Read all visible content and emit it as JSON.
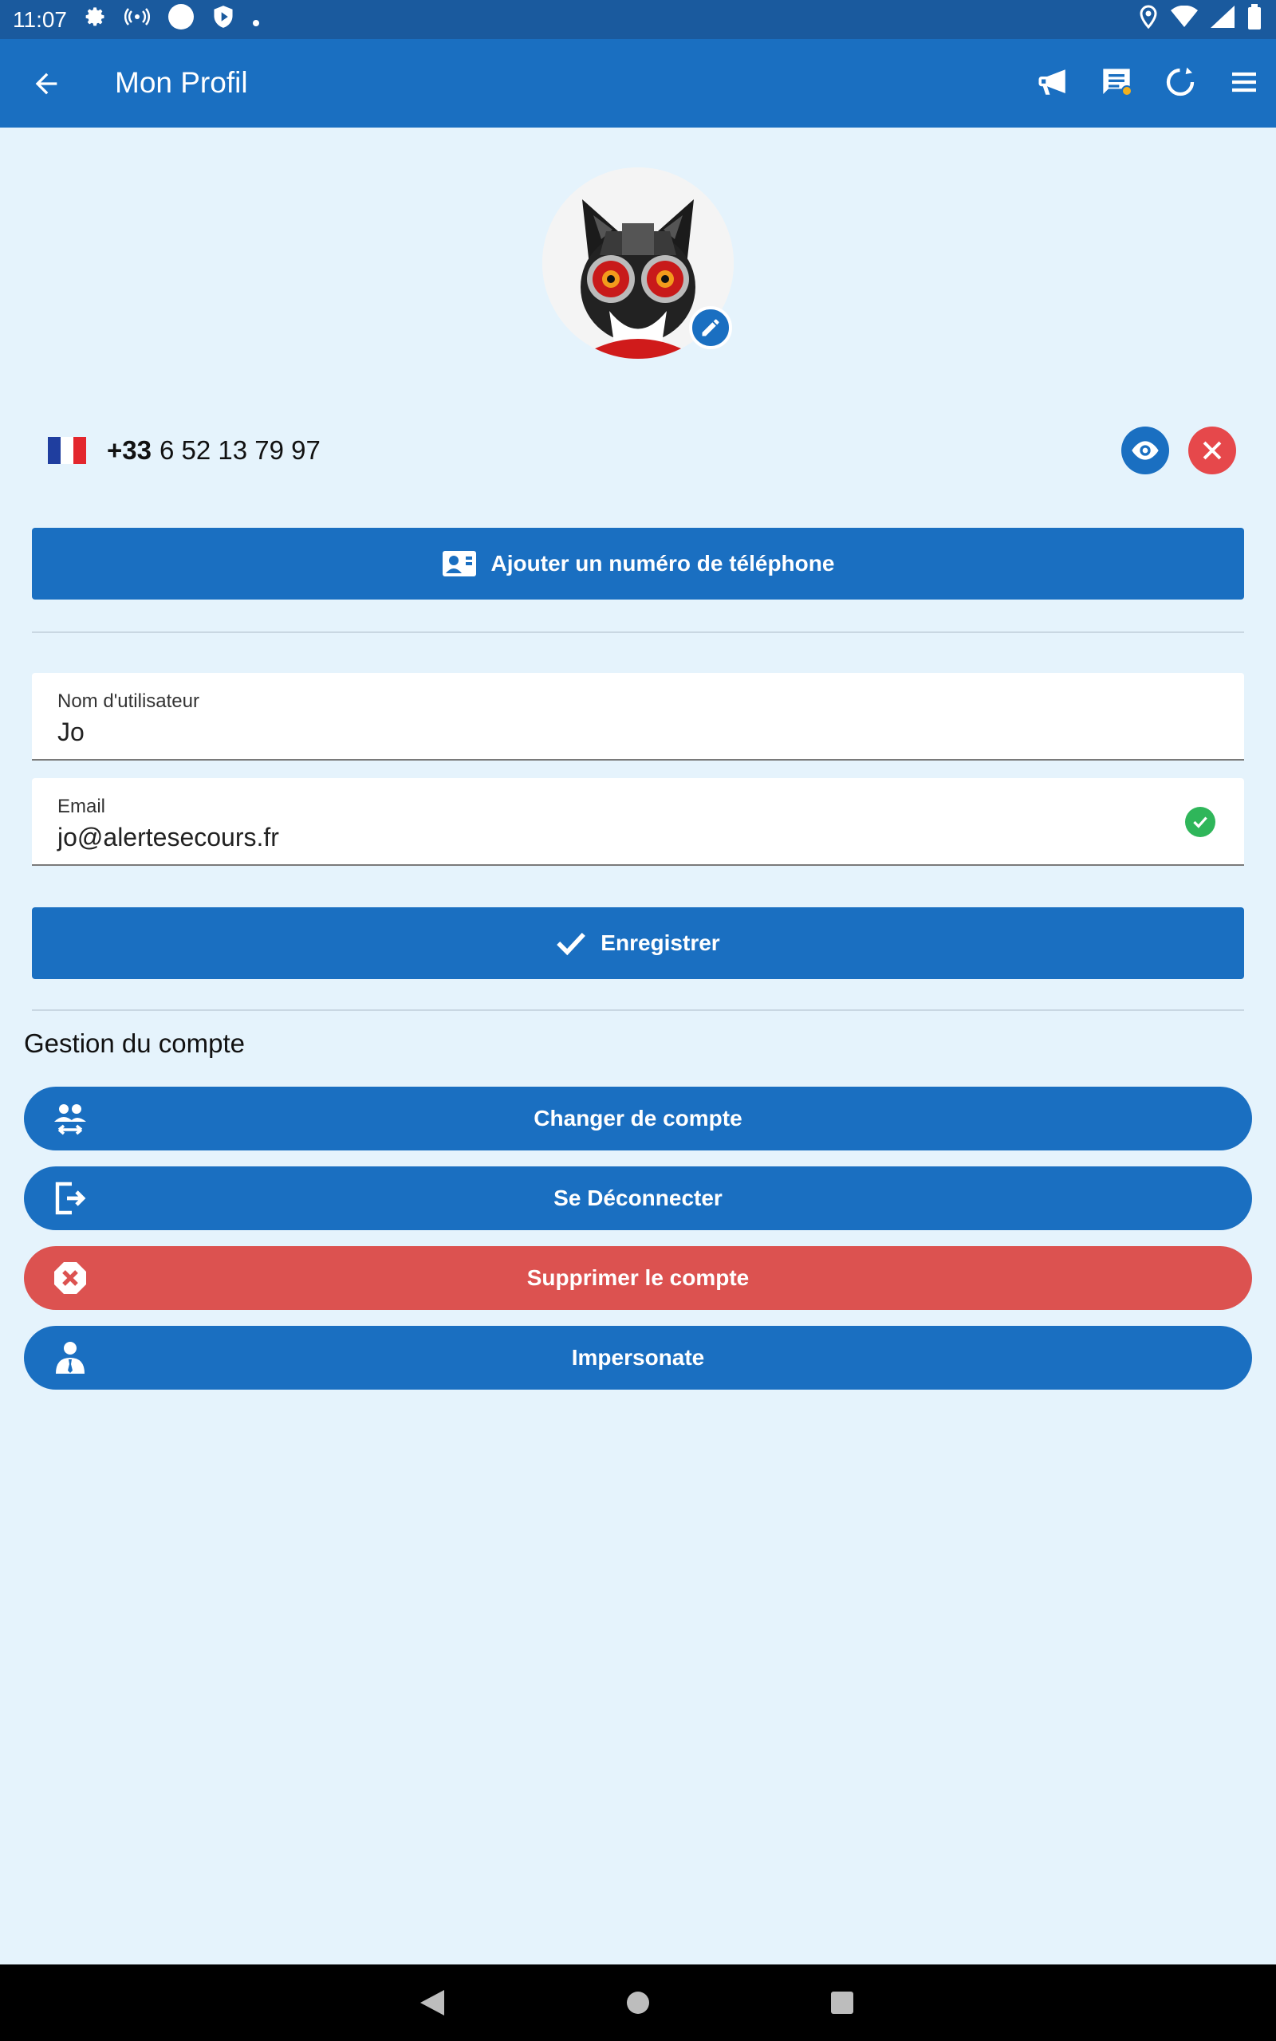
{
  "status_bar": {
    "time": "11:07",
    "icons": [
      "gear-icon",
      "wireless-icon",
      "circle-icon",
      "shield-icon",
      "dot-icon",
      "location-icon",
      "wifi-icon",
      "signal-icon",
      "battery-icon"
    ]
  },
  "app_bar": {
    "title": "Mon Profil",
    "actions": [
      "megaphone-icon",
      "messages-icon",
      "refresh-icon",
      "menu-icon"
    ]
  },
  "profile": {
    "avatar": "cat-avatar",
    "phone": {
      "country_flag": "France",
      "code": "+33",
      "number": "6 52 13 79 97"
    },
    "add_phone_label": "Ajouter un numéro de téléphone",
    "username": {
      "label": "Nom d'utilisateur",
      "value": "Jo"
    },
    "email": {
      "label": "Email",
      "value": "jo@alertesecours.fr",
      "verified": true
    },
    "save_label": "Enregistrer"
  },
  "account": {
    "section_title": "Gestion du compte",
    "buttons": [
      {
        "label": "Changer de compte",
        "icon": "switch-account-icon",
        "color": "#1a6fc1"
      },
      {
        "label": "Se Déconnecter",
        "icon": "logout-icon",
        "color": "#1a6fc1"
      },
      {
        "label": "Supprimer le compte",
        "icon": "delete-icon",
        "color": "#dc5250"
      },
      {
        "label": "Impersonate",
        "icon": "user-tie-icon",
        "color": "#1a6fc1"
      }
    ]
  },
  "colors": {
    "primary": "#1a6fc1",
    "status_bar": "#1a5a9e",
    "background": "#e5f3fc",
    "danger": "#dc5250",
    "success": "#2fb65a"
  }
}
